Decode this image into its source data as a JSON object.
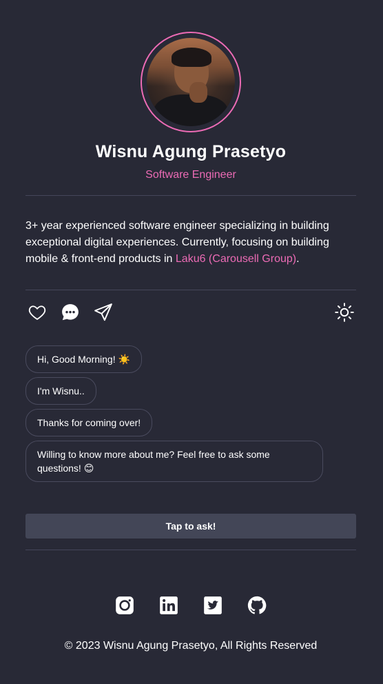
{
  "profile": {
    "name": "Wisnu Agung Prasetyo",
    "role": "Software Engineer"
  },
  "bio": {
    "text_before": "3+ year experienced software engineer specializing in building exceptional digital experiences. Currently, focusing on building mobile & front-end products in ",
    "link_text": "Laku6 (Carousell Group)",
    "text_after": "."
  },
  "actions": {
    "like_icon": "heart-icon",
    "chat_icon": "chat-bubble-icon",
    "share_icon": "send-icon",
    "theme_icon": "sun-icon"
  },
  "chat": {
    "messages": [
      "Hi, Good Morning! ☀️",
      "I'm Wisnu..",
      "Thanks for coming over!",
      "Willing to know more about me? Feel free to ask some questions! 😊"
    ],
    "ask_button": "Tap to ask!"
  },
  "socials": [
    "instagram-icon",
    "linkedin-icon",
    "twitter-icon",
    "github-icon"
  ],
  "footer": {
    "copyright": "© 2023 Wisnu Agung Prasetyo, All Rights Reserved"
  },
  "colors": {
    "background": "#282936",
    "accent": "#ec6bb5",
    "button": "#434657",
    "divider": "#45465a"
  }
}
